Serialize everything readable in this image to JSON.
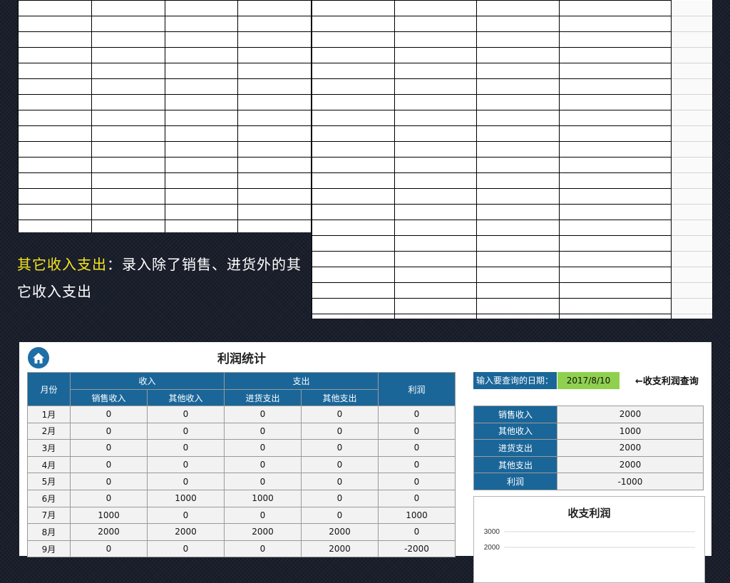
{
  "caption": {
    "highlight": "其它收入支出",
    "text": "：录入除了销售、进货外的其它收入支出"
  },
  "panel": {
    "title": "利润统计",
    "home_icon": "home-icon",
    "table": {
      "month_header": "月份",
      "income_header": "收入",
      "expense_header": "支出",
      "profit_header": "利润",
      "sub_headers": [
        "销售收入",
        "其他收入",
        "进货支出",
        "其他支出"
      ],
      "rows": [
        {
          "month": "1月",
          "sales": "0",
          "other_income": "0",
          "purchase": "0",
          "other_expense": "0",
          "profit": "0"
        },
        {
          "month": "2月",
          "sales": "0",
          "other_income": "0",
          "purchase": "0",
          "other_expense": "0",
          "profit": "0"
        },
        {
          "month": "3月",
          "sales": "0",
          "other_income": "0",
          "purchase": "0",
          "other_expense": "0",
          "profit": "0"
        },
        {
          "month": "4月",
          "sales": "0",
          "other_income": "0",
          "purchase": "0",
          "other_expense": "0",
          "profit": "0"
        },
        {
          "month": "5月",
          "sales": "0",
          "other_income": "0",
          "purchase": "0",
          "other_expense": "0",
          "profit": "0"
        },
        {
          "month": "6月",
          "sales": "0",
          "other_income": "1000",
          "purchase": "1000",
          "other_expense": "0",
          "profit": "0"
        },
        {
          "month": "7月",
          "sales": "1000",
          "other_income": "0",
          "purchase": "0",
          "other_expense": "0",
          "profit": "1000"
        },
        {
          "month": "8月",
          "sales": "2000",
          "other_income": "2000",
          "purchase": "2000",
          "other_expense": "2000",
          "profit": "0"
        },
        {
          "month": "9月",
          "sales": "0",
          "other_income": "0",
          "purchase": "0",
          "other_expense": "2000",
          "profit": "-2000"
        }
      ]
    },
    "query": {
      "label": "输入要查询的日期：",
      "date": "2017/8/10",
      "hint": "←收支利润查询"
    },
    "summary": [
      {
        "label": "销售收入",
        "value": "2000"
      },
      {
        "label": "其他收入",
        "value": "1000"
      },
      {
        "label": "进货支出",
        "value": "2000"
      },
      {
        "label": "其他支出",
        "value": "2000"
      },
      {
        "label": "利润",
        "value": "-1000"
      }
    ],
    "chart": {
      "title": "收支利润",
      "y_ticks": [
        "3000",
        "2000"
      ]
    }
  },
  "colors": {
    "header_blue": "#1a6699",
    "date_green": "#8fd14f",
    "caption_highlight": "#f6e51d"
  }
}
